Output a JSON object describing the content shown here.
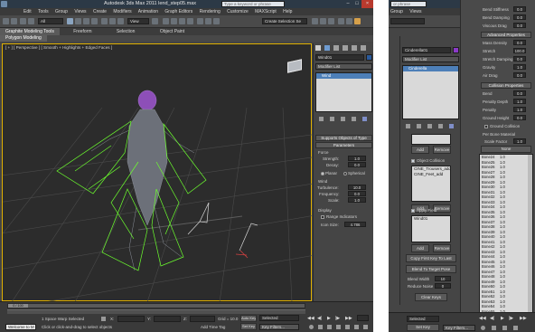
{
  "main_window": {
    "title": "Autodesk 3ds Max 2011    lend_step05.max",
    "search_placeholder": "Type a keyword or phrase",
    "menu": [
      "Edit",
      "Tools",
      "Group",
      "Views",
      "Create",
      "Modifiers",
      "Animation",
      "Graph Editors",
      "Rendering",
      "Customize",
      "MAXScript",
      "Help"
    ],
    "toolbar": {
      "all_label": "All",
      "view_label": "View",
      "selection_set": "Create Selection Se"
    },
    "ribbon_tabs": [
      "Graphite Modeling Tools",
      "Freeform",
      "Selection",
      "Object Paint"
    ],
    "sub_ribbon": "Polygon Modeling",
    "viewport_label": "[ + ] [ Perspective ] [ Smooth + Highlights + Edged Faces ]",
    "command_panel": {
      "object_name": "Wind01",
      "modifier_list": "Modifier List",
      "stack_item": "Wind",
      "rollout_supports": "Supports Objects of Type",
      "rollout_params": "Parameters",
      "force_label": "Force",
      "strength_label": "Strength:",
      "strength_value": "1.0",
      "decay_label": "Decay:",
      "decay_value": "0.0",
      "planar_label": "Planar",
      "spherical_label": "Spherical",
      "wind_label": "Wind",
      "turbulence_label": "Turbulence:",
      "turbulence_value": "10.0",
      "frequency_label": "Frequency:",
      "frequency_value": "0.0",
      "scale_label": "Scale:",
      "scale_value": "1.0",
      "display_label": "Display",
      "range_indicators_label": "Range Indicators",
      "icon_size_label": "Icon Size:",
      "icon_size_value": "4.786"
    },
    "status": {
      "timeline_position": "0 / 100",
      "selection_text": "1 Space Warp Selected",
      "prompt_text": "Click or click-and-drag to select objects",
      "welcome_text": "Welcome to M",
      "x_label": "X:",
      "y_label": "Y:",
      "z_label": "Z:",
      "grid_text": "Grid = 10.0",
      "auto_key": "Auto Key",
      "selected_dropdown": "Selected",
      "set_key": "Set Key",
      "key_filters": "Key Filters...",
      "add_time_tag": "Add Time Tag"
    }
  },
  "second_window": {
    "menu": [
      "Group",
      "Views"
    ],
    "search_placeholder": "or phrase",
    "object_name": "Cinderella01",
    "modifier_list": "Modifier List",
    "stack_item": "Cinderella",
    "add_label": "Add",
    "remove_label": "Remove",
    "object_collision_label": "Object Collision",
    "collision_items": [
      "CINE_Trousers_add",
      "CINE_Feet_add"
    ],
    "apply_field_label": "Apply Field",
    "field_items": [
      "Wind01"
    ],
    "copy_button": "Copy First Key To Last",
    "blend_button": "Blend To Target Pose",
    "blend_width_label": "Blend Width",
    "blend_width_value": "10",
    "reduce_noise_label": "Reduce Noise",
    "reduce_noise_value": "0",
    "clear_keys_button": "Clear Keys",
    "right_params": [
      {
        "label": "Bend Stiffness",
        "value": "0.0"
      },
      {
        "label": "Bend Damping",
        "value": "0.0"
      },
      {
        "label": "Viscous Drag",
        "value": "0.0"
      }
    ],
    "advanced_label": "Advanced Properties",
    "adv_params": [
      {
        "label": "Mass Density",
        "value": "0.0"
      },
      {
        "label": "Stretch",
        "value": "100.0"
      },
      {
        "label": "Stretch Damping",
        "value": "0.0"
      },
      {
        "label": "Gravity",
        "value": "1.0"
      },
      {
        "label": "Air Drag",
        "value": "0.0"
      }
    ],
    "collision_props_label": "Collision Properties",
    "coll_params": [
      {
        "label": "Bend",
        "value": "0.0"
      },
      {
        "label": "Penalty Depth",
        "value": "1.0"
      },
      {
        "label": "Penalty",
        "value": "1.0"
      },
      {
        "label": "Ground Height",
        "value": "0.0"
      }
    ],
    "ground_collision_label": "Ground Collision",
    "per_bone_label": "Per Bone Material",
    "scale_factor_label": "Scale Factor",
    "scale_factor_value": "1.0",
    "none_label": "None",
    "bones": [
      {
        "name": "Bone24",
        "value": "1.0"
      },
      {
        "name": "Bone25",
        "value": "1.0"
      },
      {
        "name": "Bone26",
        "value": "1.0"
      },
      {
        "name": "Bone27",
        "value": "1.0"
      },
      {
        "name": "Bone28",
        "value": "1.0"
      },
      {
        "name": "Bone29",
        "value": "1.0"
      },
      {
        "name": "Bone30",
        "value": "1.0"
      },
      {
        "name": "Bone31",
        "value": "1.0"
      },
      {
        "name": "Bone32",
        "value": "1.0"
      },
      {
        "name": "Bone33",
        "value": "1.0"
      },
      {
        "name": "Bone34",
        "value": "1.0"
      },
      {
        "name": "Bone35",
        "value": "1.0"
      },
      {
        "name": "Bone36",
        "value": "1.0"
      },
      {
        "name": "Bone37",
        "value": "1.0"
      },
      {
        "name": "Bone38",
        "value": "1.0"
      },
      {
        "name": "Bone39",
        "value": "1.0"
      },
      {
        "name": "Bone40",
        "value": "1.0"
      },
      {
        "name": "Bone41",
        "value": "1.0"
      },
      {
        "name": "Bone42",
        "value": "1.0"
      },
      {
        "name": "Bone43",
        "value": "1.0"
      },
      {
        "name": "Bone44",
        "value": "1.0"
      },
      {
        "name": "Bone45",
        "value": "1.0"
      },
      {
        "name": "Bone46",
        "value": "1.0"
      },
      {
        "name": "Bone47",
        "value": "1.0"
      },
      {
        "name": "Bone48",
        "value": "1.0"
      },
      {
        "name": "Bone49",
        "value": "1.0"
      },
      {
        "name": "Bone50",
        "value": "1.0"
      },
      {
        "name": "Bone51",
        "value": "1.0"
      },
      {
        "name": "Bone52",
        "value": "1.0"
      },
      {
        "name": "Bone53",
        "value": "1.0"
      },
      {
        "name": "Bone54",
        "value": "1.0"
      },
      {
        "name": "Bone55",
        "value": "1.0"
      }
    ],
    "status_selected": "Selected",
    "key_filters": "Key Filters...",
    "set_key": "Set Key"
  },
  "colors": {
    "viewport": "#2c2c2c",
    "accent": "#4d7fb8",
    "panel": "#454545",
    "cloth_wire": "#6cff2e",
    "character": "#8a8f99"
  }
}
